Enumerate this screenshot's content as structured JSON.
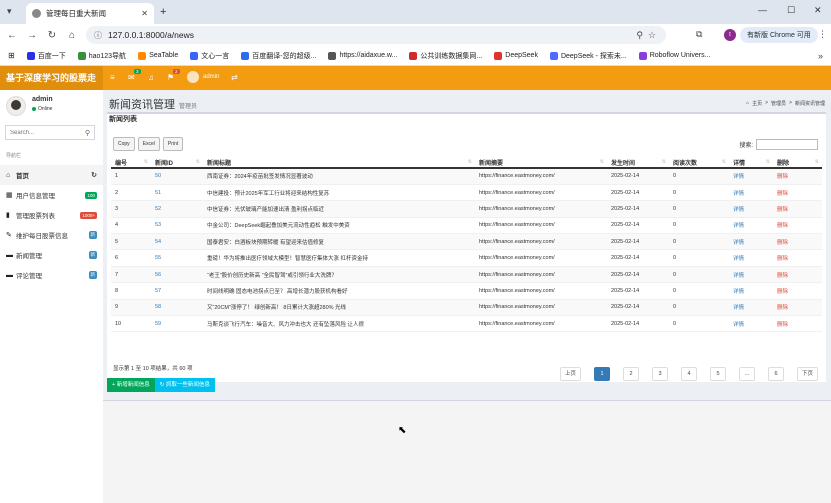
{
  "browser": {
    "tab_title": "管理每日重大新闻",
    "url": "127.0.0.1:8000/a/news",
    "update_label": "有新版 Chrome 可用",
    "profile_initial": "t",
    "bookmarks": [
      {
        "label": "百度一下",
        "color": "#2932e1"
      },
      {
        "label": "hao123导航",
        "color": "#3a8f3a"
      },
      {
        "label": "SeaTable",
        "color": "#ff8a00"
      },
      {
        "label": "文心一言",
        "color": "#3b63f3"
      },
      {
        "label": "百度翻译-您的超级...",
        "color": "#2f6cf0"
      },
      {
        "label": "https://aidaxue.w...",
        "color": "#555555"
      },
      {
        "label": "公共训练数据集网...",
        "color": "#d12c2c"
      },
      {
        "label": "DeepSeek",
        "color": "#e0322f"
      },
      {
        "label": "DeepSeek - 探索未...",
        "color": "#4d6bfe"
      },
      {
        "label": "Roboflow Univers...",
        "color": "#8b3fd9"
      }
    ]
  },
  "app": {
    "logo": "基于深度学习的股票走",
    "header_badge_1": "3",
    "header_badge_2": "2",
    "header_user": "admin"
  },
  "sidebar": {
    "user_name": "admin",
    "user_status": "Online",
    "search_placeholder": "Search...",
    "nav_header": "导航栏",
    "items": [
      {
        "label": "首页",
        "icon": "home-icon",
        "glyph": "⌂",
        "badge": "",
        "badge_color": ""
      },
      {
        "label": "用户信息管理",
        "icon": "table-icon",
        "glyph": "▦",
        "badge": "100",
        "badge_color": "#00a65a"
      },
      {
        "label": "管理股票列表",
        "icon": "chart-icon",
        "glyph": "▮",
        "badge": "1000+",
        "badge_color": "#dd4b39"
      },
      {
        "label": "维护每日股票信息",
        "icon": "edit-icon",
        "glyph": "✎",
        "badge": "新",
        "badge_color": "#3c8dbc"
      },
      {
        "label": "新闻管理",
        "icon": "comment-icon",
        "glyph": "▬",
        "badge": "新",
        "badge_color": "#3c8dbc"
      },
      {
        "label": "评论管理",
        "icon": "comment-icon",
        "glyph": "▬",
        "badge": "新",
        "badge_color": "#3c8dbc"
      }
    ]
  },
  "content": {
    "title": "新闻资讯管理",
    "subtitle": "管理员",
    "breadcrumb": [
      "主页",
      "管理员",
      "新闻资讯管理"
    ],
    "box_title": "新闻列表",
    "buttons": [
      "Copy",
      "Excel",
      "Print"
    ],
    "search_label": "搜索:",
    "columns": [
      "编号",
      "新闻ID",
      "新闻标题",
      "新闻摘要",
      "发生时间",
      "阅读次数",
      "详情",
      "删除"
    ],
    "rows": [
      [
        "1",
        "50",
        "西南证券：2024年疫苗批签发情况显著波动",
        "https://finance.eastmoney.com/",
        "2025-02-14",
        "0",
        "详情",
        "删除"
      ],
      [
        "2",
        "51",
        "中信建投：预计2025年军工行业将迎来结构性复苏",
        "https://finance.eastmoney.com/",
        "2025-02-14",
        "0",
        "详情",
        "删除"
      ],
      [
        "3",
        "52",
        "中信证券：光伏玻璃产能加速出清 盈利拐点临近",
        "https://finance.eastmoney.com/",
        "2025-02-14",
        "0",
        "详情",
        "删除"
      ],
      [
        "4",
        "53",
        "中金公司：DeepSeek崛起叠加美元流动性趋松 触发中美资",
        "https://finance.eastmoney.com/",
        "2025-02-14",
        "0",
        "详情",
        "删除"
      ],
      [
        "5",
        "54",
        "国泰君安：白酒板块预期转暖 有望迎来估值修复",
        "https://finance.eastmoney.com/",
        "2025-02-14",
        "0",
        "详情",
        "删除"
      ],
      [
        "6",
        "55",
        "重磅！华为将推出医疗领域大模型！智慧医疗集体大涨 杠杆资金持",
        "https://finance.eastmoney.com/",
        "2025-02-14",
        "0",
        "详情",
        "删除"
      ],
      [
        "7",
        "56",
        "“老王”股价创历史新高 “全民智驾”或引领行业大洗牌？",
        "https://finance.eastmoney.com/",
        "2025-02-14",
        "0",
        "详情",
        "删除"
      ],
      [
        "8",
        "57",
        "时间线明确 固态电池拐点已至？ 高增长潜力股获机构看好",
        "https://finance.eastmoney.com/",
        "2025-02-14",
        "0",
        "详情",
        "删除"
      ],
      [
        "9",
        "58",
        "又“20CM”涨停了！ 绿创新高！ 8日累计大涨超280% 光线",
        "https://finance.eastmoney.com/",
        "2025-02-14",
        "0",
        "详情",
        "删除"
      ],
      [
        "10",
        "59",
        "马斯克谈飞行汽车：噪音大、风力冲击也大 还有坠落风险 让人很",
        "https://finance.eastmoney.com/",
        "2025-02-14",
        "0",
        "详情",
        "删除"
      ]
    ],
    "info": "显示第 1 至 10 项结果，共 60 项",
    "pager": {
      "prev": "上页",
      "pages": [
        "1",
        "2",
        "3",
        "4",
        "5",
        "...",
        "6"
      ],
      "next": "下页"
    },
    "action_add": "新增新闻信息",
    "action_fetch": "抓取一些新闻信息"
  }
}
